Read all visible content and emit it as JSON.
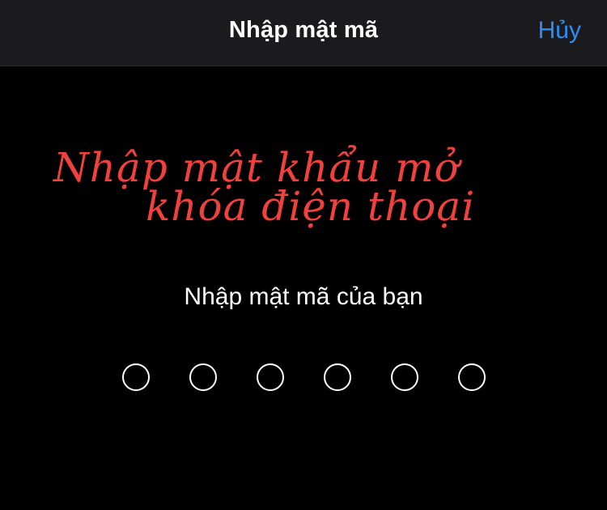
{
  "nav": {
    "title": "Nhập mật mã",
    "cancel_label": "Hủy",
    "accent_color": "#2f8cf5"
  },
  "overlay": {
    "line1": "Nhập mật khẩu mở",
    "line2": "khóa điện thoại",
    "color": "#f0413d"
  },
  "passcode": {
    "prompt": "Nhập mật mã của bạn",
    "digits_total": 6,
    "digits_entered": 0
  }
}
